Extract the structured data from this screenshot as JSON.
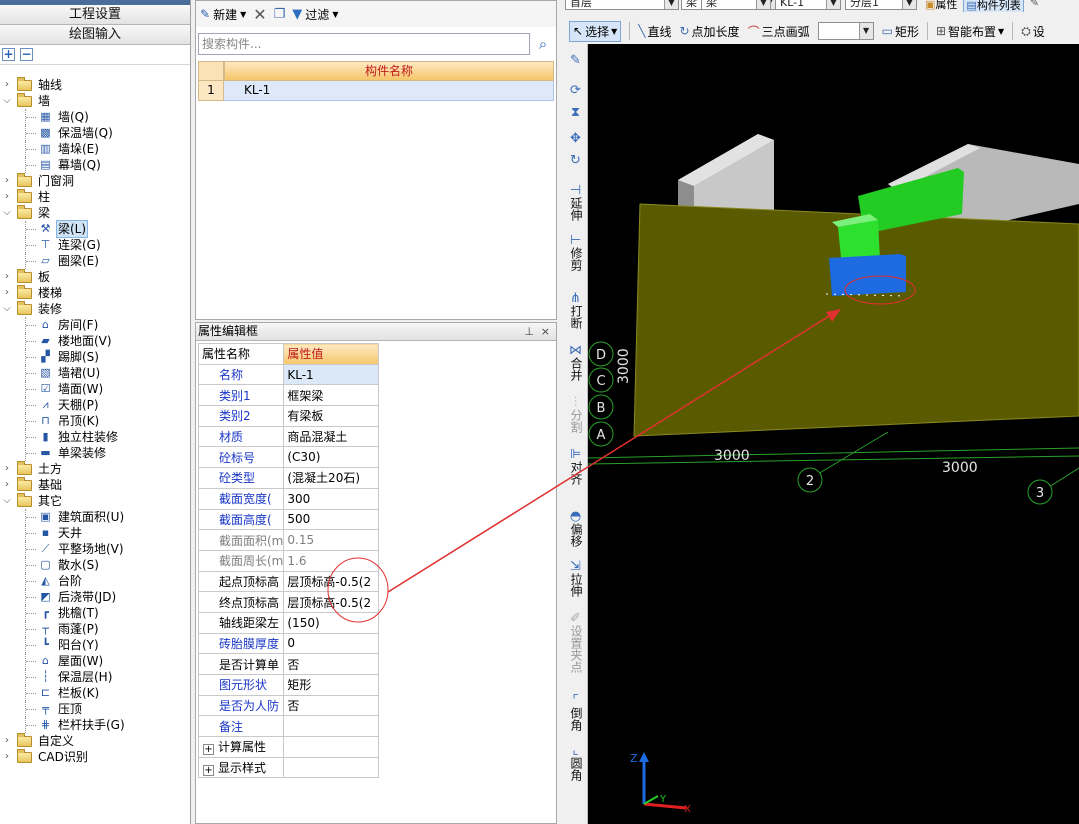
{
  "left_panel": {
    "buttons": [
      "工程设置",
      "绘图输入"
    ],
    "expand_btn": "+",
    "collapse_btn": "−",
    "tree": [
      {
        "label": "轴线",
        "level": 0,
        "open": false,
        "icon": "folder-icon"
      },
      {
        "label": "墙",
        "level": 0,
        "open": true,
        "icon": "folder-icon"
      },
      {
        "label": "墙(Q)",
        "level": 1,
        "icon": "wall-icon"
      },
      {
        "label": "保温墙(Q)",
        "level": 1,
        "icon": "insulation-wall-icon"
      },
      {
        "label": "墙垛(E)",
        "level": 1,
        "icon": "wall-pier-icon"
      },
      {
        "label": "幕墙(Q)",
        "level": 1,
        "icon": "curtain-wall-icon"
      },
      {
        "label": "门窗洞",
        "level": 0,
        "open": false,
        "icon": "folder-icon"
      },
      {
        "label": "柱",
        "level": 0,
        "open": false,
        "icon": "folder-icon"
      },
      {
        "label": "梁",
        "level": 0,
        "open": true,
        "icon": "folder-icon"
      },
      {
        "label": "梁(L)",
        "level": 1,
        "icon": "beam-icon",
        "selected": true
      },
      {
        "label": "连梁(G)",
        "level": 1,
        "icon": "link-beam-icon"
      },
      {
        "label": "圈梁(E)",
        "level": 1,
        "icon": "ring-beam-icon"
      },
      {
        "label": "板",
        "level": 0,
        "open": false,
        "icon": "folder-icon"
      },
      {
        "label": "楼梯",
        "level": 0,
        "open": false,
        "icon": "folder-icon"
      },
      {
        "label": "装修",
        "level": 0,
        "open": true,
        "icon": "folder-icon"
      },
      {
        "label": "房间(F)",
        "level": 1,
        "icon": "room-icon"
      },
      {
        "label": "楼地面(V)",
        "level": 1,
        "icon": "floor-icon"
      },
      {
        "label": "踢脚(S)",
        "level": 1,
        "icon": "skirting-icon"
      },
      {
        "label": "墙裙(U)",
        "level": 1,
        "icon": "dado-icon"
      },
      {
        "label": "墙面(W)",
        "level": 1,
        "icon": "wall-finish-icon"
      },
      {
        "label": "天棚(P)",
        "level": 1,
        "icon": "ceiling-icon"
      },
      {
        "label": "吊顶(K)",
        "level": 1,
        "icon": "suspended-ceiling-icon"
      },
      {
        "label": "独立柱装修",
        "level": 1,
        "icon": "column-finish-icon"
      },
      {
        "label": "单梁装修",
        "level": 1,
        "icon": "beam-finish-icon"
      },
      {
        "label": "土方",
        "level": 0,
        "open": false,
        "icon": "folder-icon"
      },
      {
        "label": "基础",
        "level": 0,
        "open": false,
        "icon": "folder-icon"
      },
      {
        "label": "其它",
        "level": 0,
        "open": true,
        "icon": "folder-icon"
      },
      {
        "label": "建筑面积(U)",
        "level": 1,
        "icon": "building-area-icon"
      },
      {
        "label": "天井",
        "level": 1,
        "icon": "patio-icon"
      },
      {
        "label": "平整场地(V)",
        "level": 1,
        "icon": "site-leveling-icon"
      },
      {
        "label": "散水(S)",
        "level": 1,
        "icon": "apron-icon"
      },
      {
        "label": "台阶",
        "level": 1,
        "icon": "steps-icon"
      },
      {
        "label": "后浇带(JD)",
        "level": 1,
        "icon": "post-pour-strip-icon"
      },
      {
        "label": "挑檐(T)",
        "level": 1,
        "icon": "eave-icon"
      },
      {
        "label": "雨蓬(P)",
        "level": 1,
        "icon": "canopy-icon"
      },
      {
        "label": "阳台(Y)",
        "level": 1,
        "icon": "balcony-icon"
      },
      {
        "label": "屋面(W)",
        "level": 1,
        "icon": "roof-icon"
      },
      {
        "label": "保温层(H)",
        "level": 1,
        "icon": "insulation-layer-icon"
      },
      {
        "label": "栏板(K)",
        "level": 1,
        "icon": "parapet-icon"
      },
      {
        "label": "压顶",
        "level": 1,
        "icon": "coping-icon"
      },
      {
        "label": "栏杆扶手(G)",
        "level": 1,
        "icon": "railing-icon"
      },
      {
        "label": "自定义",
        "level": 0,
        "open": false,
        "icon": "folder-icon"
      },
      {
        "label": "CAD识别",
        "level": 0,
        "open": false,
        "icon": "folder-icon"
      }
    ]
  },
  "component_panel": {
    "toolbar": {
      "new_label": "新建",
      "filter_label": "过滤"
    },
    "search_placeholder": "搜索构件...",
    "column_header": "构件名称",
    "rows": [
      {
        "index": "1",
        "name": "KL-1"
      }
    ]
  },
  "property_panel": {
    "title": "属性编辑框",
    "pin": "⊥",
    "close": "×",
    "header": {
      "name": "属性名称",
      "value": "属性值"
    },
    "rows": [
      {
        "name": "名称",
        "value": "KL-1",
        "style": "blue",
        "selected": true
      },
      {
        "name": "类别1",
        "value": "框架梁",
        "style": "blue"
      },
      {
        "name": "类别2",
        "value": "有梁板",
        "style": "blue"
      },
      {
        "name": "材质",
        "value": "商品混凝土",
        "style": "blue"
      },
      {
        "name": "砼标号",
        "value": "(C30)",
        "style": "blue"
      },
      {
        "name": "砼类型",
        "value": "(混凝土20石)",
        "style": "blue"
      },
      {
        "name": "截面宽度(",
        "value": "300",
        "style": "blue"
      },
      {
        "name": "截面高度(",
        "value": "500",
        "style": "blue"
      },
      {
        "name": "截面面积(m",
        "value": "0.15",
        "style": "grey"
      },
      {
        "name": "截面周长(m",
        "value": "1.6",
        "style": "grey"
      },
      {
        "name": "起点顶标高",
        "value": "层顶标高-0.5(2",
        "style": "black"
      },
      {
        "name": "终点顶标高",
        "value": "层顶标高-0.5(2",
        "style": "black"
      },
      {
        "name": "轴线距梁左",
        "value": "(150)",
        "style": "black"
      },
      {
        "name": "砖胎膜厚度",
        "value": "0",
        "style": "blue"
      },
      {
        "name": "是否计算单",
        "value": "否",
        "style": "black"
      },
      {
        "name": "图元形状",
        "value": "矩形",
        "style": "blue"
      },
      {
        "name": "是否为人防",
        "value": "否",
        "style": "blue"
      },
      {
        "name": "备注",
        "value": "",
        "style": "blue"
      }
    ],
    "expand_rows": [
      "计算属性",
      "显示样式"
    ]
  },
  "cad_toolbar": {
    "combos": [
      "首层",
      "梁",
      "梁",
      "KL-1",
      "分层1"
    ],
    "tabs": [
      "属性",
      "构件列表"
    ],
    "tools": [
      "选择",
      "直线",
      "点加长度",
      "三点画弧",
      "矩形",
      "智能布置",
      "设"
    ]
  },
  "vertical_toolbar": [
    {
      "label": "",
      "icon": "brush-icon",
      "disabled": false
    },
    {
      "label": "",
      "icon": "copy-icon",
      "disabled": false
    },
    {
      "label": "",
      "icon": "mirror-icon",
      "disabled": false
    },
    {
      "label": "",
      "icon": "move-icon",
      "disabled": false
    },
    {
      "label": "",
      "icon": "rotate-icon",
      "disabled": false
    },
    {
      "label": "延伸",
      "icon": "extend-icon",
      "disabled": false
    },
    {
      "label": "修剪",
      "icon": "trim-icon",
      "disabled": false
    },
    {
      "label": "打断",
      "icon": "break-icon",
      "disabled": false
    },
    {
      "label": "合并",
      "icon": "merge-icon",
      "disabled": false
    },
    {
      "label": "分割",
      "icon": "split-icon",
      "disabled": true
    },
    {
      "label": "对齐",
      "icon": "align-icon",
      "disabled": false
    },
    {
      "label": "偏移",
      "icon": "offset-icon",
      "disabled": false
    },
    {
      "label": "拉伸",
      "icon": "stretch-icon",
      "disabled": false
    },
    {
      "label": "设置夹点",
      "icon": "grip-icon",
      "disabled": true
    },
    {
      "label": "倒角",
      "icon": "chamfer-icon",
      "disabled": false
    },
    {
      "label": "圆角",
      "icon": "fillet-icon",
      "disabled": false
    }
  ],
  "viewport": {
    "axes_labels": [
      "D",
      "C",
      "B",
      "A",
      "2",
      "3"
    ],
    "dimensions": [
      "3000",
      "3000",
      "3000"
    ],
    "axis_letters": [
      "Z",
      "Y",
      "X"
    ],
    "colors": {
      "slab": "#5a5a00",
      "green_beam": "#2ee02e",
      "blue_block": "#1e6ae0",
      "annotation": "#e03030"
    }
  }
}
